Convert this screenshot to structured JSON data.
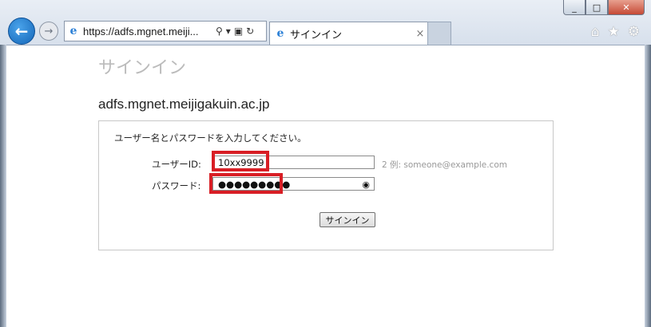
{
  "browser": {
    "address_url": "https://adfs.mgnet.meiji...",
    "tab_title": "サインイン",
    "tab_close": "×",
    "window_buttons": {
      "minimize": "_",
      "maximize": "□",
      "close": "✕"
    },
    "icons": [
      "back-arrow-icon",
      "forward-arrow-icon",
      "ie-logo-icon",
      "search-icon",
      "lock-icon",
      "refresh-icon",
      "home-icon",
      "favorites-star-icon",
      "settings-gear-icon"
    ]
  },
  "page": {
    "title": "サインイン",
    "host": "adfs.mgnet.meijigakuin.ac.jp",
    "instructions": "ユーザー名とパスワードを入力してください。",
    "username_label": "ユーザーID:",
    "username_value": "10xx9999",
    "username_hint": "2 例: someone@example.com",
    "password_label": "パスワード:",
    "password_value": "●●●●●●●●●",
    "signin_button": "サインイン"
  },
  "colors": {
    "highlight": "#d81e25",
    "title_gray": "#bbbbbb"
  }
}
